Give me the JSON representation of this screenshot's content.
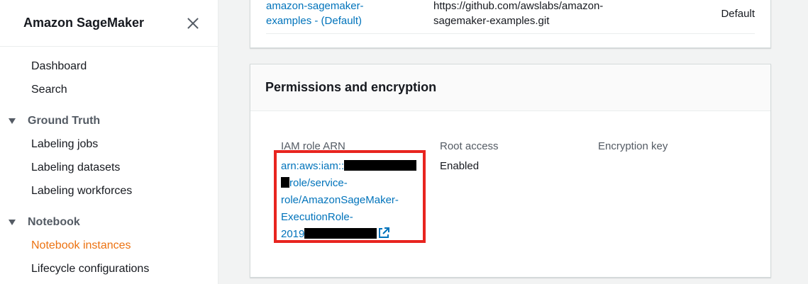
{
  "sidebar": {
    "title": "Amazon SageMaker",
    "items": {
      "dashboard": "Dashboard",
      "search": "Search",
      "ground_truth": "Ground Truth",
      "labeling_jobs": "Labeling jobs",
      "labeling_datasets": "Labeling datasets",
      "labeling_workforces": "Labeling workforces",
      "notebook": "Notebook",
      "notebook_instances": "Notebook instances",
      "lifecycle_configurations": "Lifecycle configurations"
    }
  },
  "repo": {
    "name_line1": "amazon-sagemaker-",
    "name_line2": "examples - (Default)",
    "url_line1": "https://github.com/awslabs/amazon-",
    "url_line2": "sagemaker-examples.git",
    "status": "Default"
  },
  "permissions": {
    "title": "Permissions and encryption",
    "iam_label": "IAM role ARN",
    "root_label": "Root access",
    "encryption_label": "Encryption key",
    "root_value": "Enabled",
    "arn_part1": "arn:aws:iam::",
    "arn_part2": "role/service-",
    "arn_part3": "role/AmazonSageMaker-",
    "arn_part4": "ExecutionRole-",
    "arn_part5": "2019"
  },
  "colors": {
    "accent_active": "#ec7211",
    "link": "#0073bb",
    "highlight": "#e8241f"
  },
  "icons": [
    "close-icon",
    "caret-down-icon",
    "external-link-icon"
  ]
}
